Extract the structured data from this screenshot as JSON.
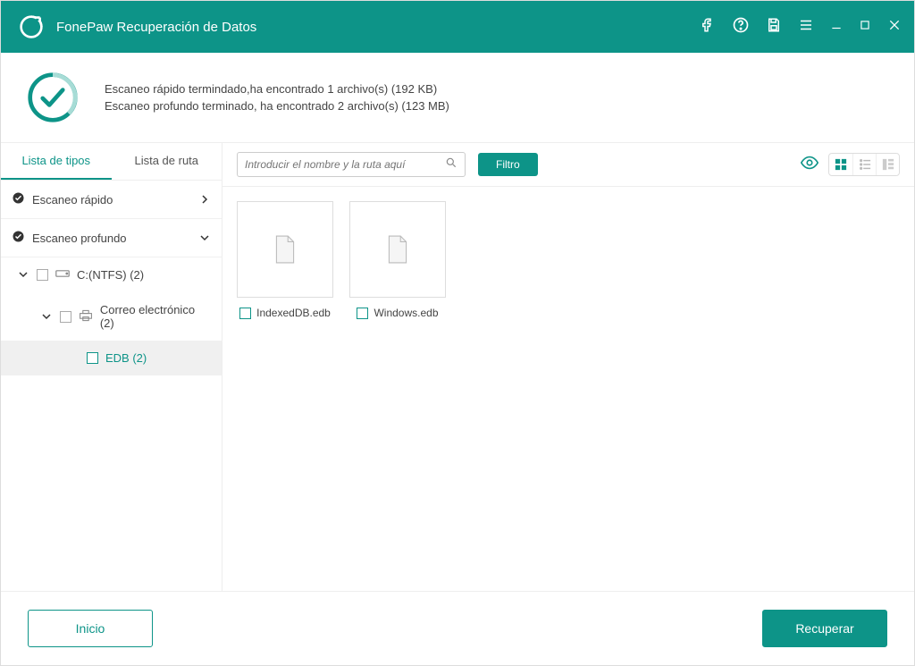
{
  "colors": {
    "accent": "#0d9488"
  },
  "titlebar": {
    "title": "FonePaw Recuperación de Datos"
  },
  "header": {
    "quick_msg": "Escaneo rápido termindado,ha encontrado 1 archivo(s) (192 KB)",
    "deep_msg": "Escaneo profundo terminado, ha encontrado 2 archivo(s) (123 MB)"
  },
  "tabs": {
    "types": "Lista de tipos",
    "path": "Lista de ruta"
  },
  "tree": {
    "quick_scan": "Escaneo rápido",
    "deep_scan": "Escaneo profundo",
    "drive": "C:(NTFS) (2)",
    "email": "Correo electrónico (2)",
    "edb": "EDB (2)"
  },
  "toolbar": {
    "search_placeholder": "Introducir el nombre y la ruta aquí",
    "filter_label": "Filtro"
  },
  "files": [
    {
      "name": "IndexedDB.edb"
    },
    {
      "name": "Windows.edb"
    }
  ],
  "footer": {
    "home": "Inicio",
    "recover": "Recuperar"
  }
}
